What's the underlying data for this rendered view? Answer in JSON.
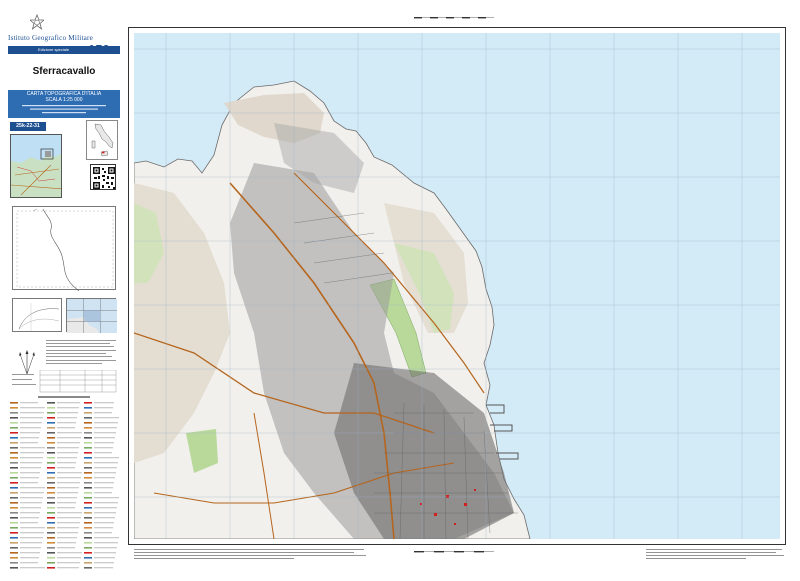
{
  "header": {
    "institute": "Istituto Geografico Militare",
    "edition_label": "Edizione speciale",
    "anniversary": "150"
  },
  "sheet": {
    "name": "Sferracavallo",
    "series_line1": "CARTA TOPOGRAFICA D'ITALIA",
    "series_line2": "SCALA 1:25 000",
    "code": "25k-22-31"
  },
  "colors": {
    "brand_blue": "#1d4f91",
    "box_blue": "#2f6db3",
    "sea": "#d3eaf7",
    "land": "#f2f0ec",
    "urban": "#8a8a8a",
    "road_major": "#b5651d",
    "park_green": "#b8d99a"
  },
  "icons": [
    "italian-republic-emblem-icon",
    "north-arrow-icon",
    "qr-code-icon"
  ]
}
